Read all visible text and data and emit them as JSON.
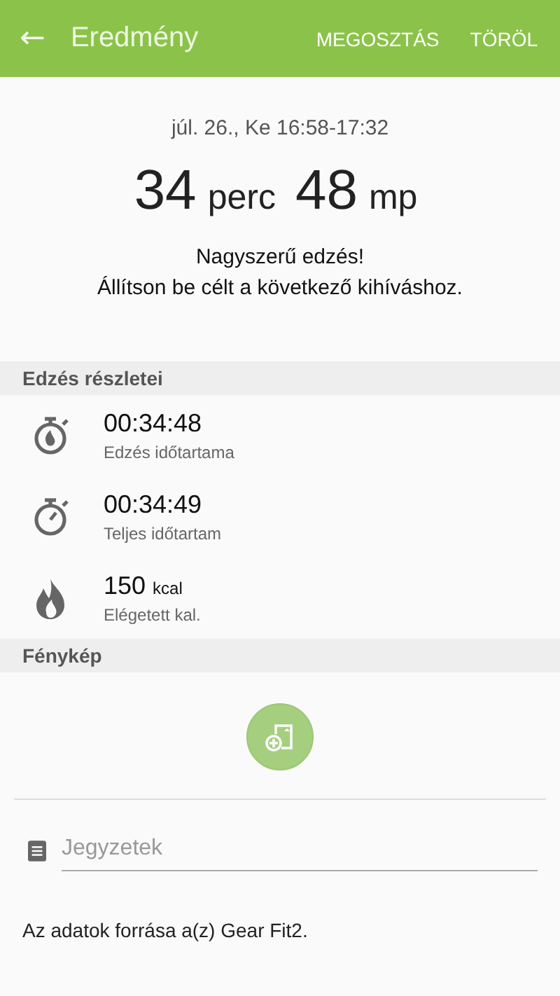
{
  "app_bar": {
    "back_icon": "←",
    "title": "Eredmény",
    "actions": [
      "MEGOSZTÁS",
      "TÖRÖL"
    ]
  },
  "summary": {
    "date": "júl. 26., Ke 16:58-17:32",
    "duration": [
      {
        "value": "34",
        "unit": "perc"
      },
      {
        "value": "48",
        "unit": "mp"
      }
    ],
    "message": [
      "Nagyszerű edzés!",
      "Állítson be célt a következő kihíváshoz."
    ]
  },
  "details": {
    "title": "Edzés részletei",
    "items": [
      {
        "kind": "workout-timer",
        "value": "00:34:48",
        "label": "Edzés időtartama"
      },
      {
        "kind": "timer",
        "value": "00:34:49",
        "label": "Teljes időtartam"
      },
      {
        "kind": "flame",
        "value": "150",
        "unit": "kcal",
        "label": "Elégetett kal."
      }
    ]
  },
  "photo": {
    "title": "Fénykép"
  },
  "notes": {
    "placeholder": "Jegyzetek"
  },
  "source": "Az adatok forrása a(z) Gear Fit2."
}
